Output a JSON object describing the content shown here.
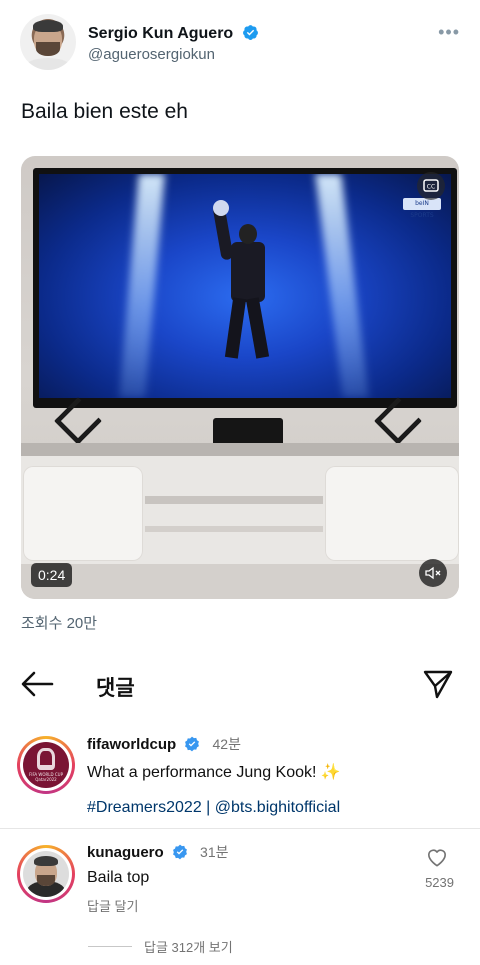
{
  "tweet": {
    "author_name": "Sergio Kun Aguero",
    "author_handle": "@aguerosergiokun",
    "text": "Baila bien este eh",
    "video": {
      "time": "0:24",
      "tv_logo_text": "beIN SPORTS"
    },
    "view_count": "조회수 20만"
  },
  "comments_header": {
    "title": "댓글"
  },
  "comments": [
    {
      "username": "fifaworldcup",
      "time": "42분",
      "text": "What a performance Jung Kook! ✨",
      "tags": "#Dreamers2022 | @bts.bighitofficial",
      "avatar_text": "FIFA WORLD CUP Qatar2022"
    },
    {
      "username": "kunaguero",
      "time": "31분",
      "text": "Baila top",
      "reply_label": "답글 달기",
      "likes": "5239"
    }
  ],
  "view_replies": "답글 312개 보기",
  "colors": {
    "twitter_blue": "#1d9bf0",
    "ig_blue": "#3897f0",
    "link": "#00376b",
    "muted": "#737373"
  }
}
